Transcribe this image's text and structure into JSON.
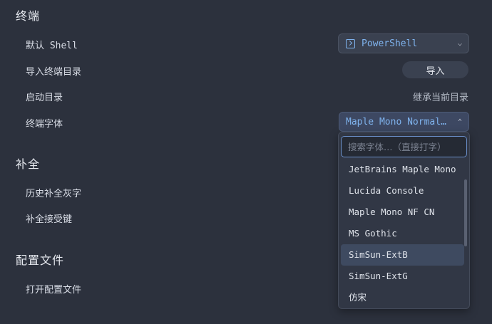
{
  "sections": {
    "terminal": "终端",
    "completion": "补全",
    "config": "配置文件"
  },
  "terminal": {
    "default_shell_label": "默认 Shell",
    "default_shell_value": "PowerShell",
    "import_dir_label": "导入终端目录",
    "import_button": "导入",
    "start_dir_label": "启动目录",
    "start_dir_value": "继承当前目录",
    "font_label": "终端字体",
    "font_value": "Maple Mono Normal NF CN"
  },
  "completion": {
    "history_gray_label": "历史补全灰字",
    "accept_key_label": "补全接受键"
  },
  "config": {
    "open_config_label": "打开配置文件"
  },
  "font_dropdown": {
    "search_placeholder": "搜索字体…（直接打字）",
    "options": [
      "JetBrains Maple Mono",
      "Lucida Console",
      "Maple Mono NF CN",
      "MS Gothic",
      "SimSun-ExtB",
      "SimSun-ExtG",
      "仿宋"
    ],
    "highlighted": "SimSun-ExtB"
  },
  "icons": {
    "shell": "terminal-icon",
    "chevron_down": "chevron-down-icon",
    "chevron_up": "chevron-up-icon"
  },
  "colors": {
    "background": "#2c313d",
    "accent": "#7fb3ee"
  }
}
